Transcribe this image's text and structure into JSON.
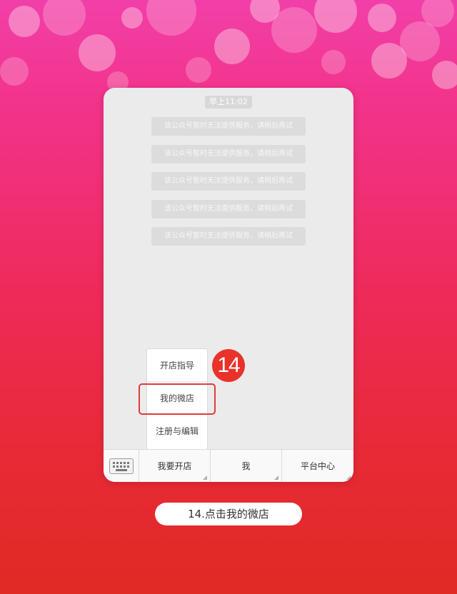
{
  "chat": {
    "timestamp": "早上11:02",
    "messages": [
      "该公众号暂时无法提供服务，请稍后再试",
      "该公众号暂时无法提供服务，请稍后再试",
      "该公众号暂时无法提供服务，请稍后再试",
      "该公众号暂时无法提供服务，请稍后再试",
      "该公众号暂时无法提供服务，请稍后再试"
    ]
  },
  "menu": {
    "items": [
      "开店指导",
      "我的微店",
      "注册与编辑"
    ],
    "highlighted": "我的微店"
  },
  "step": {
    "number": "14"
  },
  "bottom_bar": {
    "keyboard_icon": "keyboard-icon",
    "tabs": [
      "我要开店",
      "我",
      "平台中心"
    ]
  },
  "caption": "14.点击我的微店",
  "colors": {
    "accent": "#e8322a",
    "background_top": "#f23fa8",
    "background_bottom": "#e02a24"
  }
}
